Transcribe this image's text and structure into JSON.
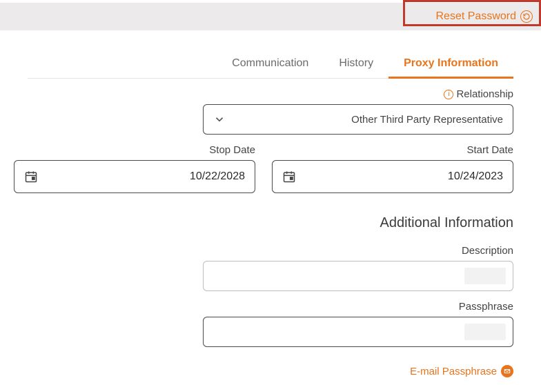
{
  "header": {
    "reset_password_label": "Reset Password"
  },
  "tabs": [
    {
      "label": "Proxy Information",
      "active": true
    },
    {
      "label": "History",
      "active": false
    },
    {
      "label": "Communication",
      "active": false
    }
  ],
  "form": {
    "relationship": {
      "label": "Relationship",
      "selected": "Other Third Party Representative",
      "options": [
        "Other Third Party Representative"
      ]
    },
    "start_date": {
      "label": "Start Date",
      "value": "10/24/2023"
    },
    "stop_date": {
      "label": "Stop Date",
      "value": "10/22/2028"
    }
  },
  "additional": {
    "heading": "Additional Information",
    "description": {
      "label": "Description",
      "value": ""
    },
    "passphrase": {
      "label": "Passphrase",
      "value": ""
    },
    "email_passphrase_label": "E-mail Passphrase"
  }
}
